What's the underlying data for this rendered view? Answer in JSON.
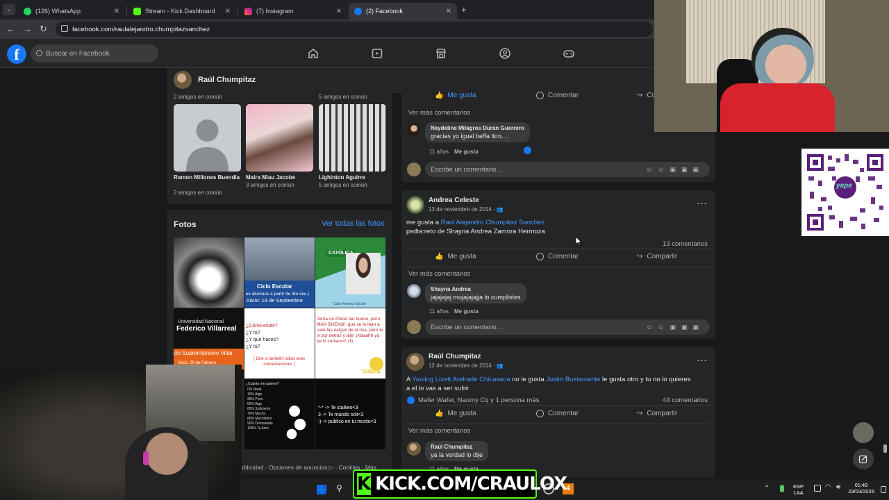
{
  "browser": {
    "tabs": [
      {
        "label": "(126) WhatsApp",
        "color": "#25d366",
        "icon": "whatsapp-icon"
      },
      {
        "label": "Stream - Kick Dashboard",
        "color": "#53fc18",
        "icon": "kick-icon"
      },
      {
        "label": "(7) Instagram",
        "color": "#e1306c",
        "icon": "instagram-icon"
      },
      {
        "label": "(2) Facebook",
        "color": "#1877f2",
        "icon": "facebook-icon"
      }
    ],
    "new_tab": "+",
    "url": "facebook.com/raulalejandro.chumpitazsanchez"
  },
  "header": {
    "logo": "f",
    "search_placeholder": "Buscar en Facebook",
    "nav_icons": [
      "home-icon",
      "video-icon",
      "marketplace-icon",
      "groups-icon",
      "gaming-icon"
    ]
  },
  "profile": {
    "name": "Raúl Chumpitaz"
  },
  "friends": {
    "top_subs": [
      "2 amigos en común",
      "5 amigos en común"
    ],
    "items": [
      {
        "name": "Ramon Millones Buendia",
        "mutual": "2 amigos en común"
      },
      {
        "name": "Maira Miau Jacobe",
        "mutual": "3 amigos en común"
      },
      {
        "name": "Lighinton Aguirre",
        "mutual": "5 amigos en común"
      }
    ]
  },
  "photos": {
    "title": "Fotos",
    "see_all": "Ver todas las fotos",
    "captions": {
      "p2a": "Ciclo Escolar",
      "p2b": "ex alumnos a partir de 4to sec.)",
      "p2c": "Inicio: 19 de Septiembre",
      "p3a": "CATÓLICA",
      "p3b": "Ciclo Primera Opción",
      "p4a": "Universidad Nacional",
      "p4b": "Federico Villarreal",
      "p4c": "clo Superintensivo Villar",
      "p4d": "Inicio: 29 de Febrero",
      "p5a": "¿Cómo estás?",
      "p5b": "¿Y tú?",
      "p5c": "¿Y qué haces?",
      "p5d": "¿Y tú?",
      "p5e": "( Like si también odias esas conversaciones )",
      "p6a": "Tenía un chiste tan bueno, pero MAN BUENO!, que se le iban a caer las nalgas de la risa, pero te vi por detrás y dije: ¡Naaahh ya se lo contaron! xD",
      "p6b": "CHISTE",
      "p7a": "¿Cuánto me quieres?",
      "p7b": "0% Nada",
      "p7c": "10% Algo",
      "p7d": "25% Poco",
      "p7e": "50% Algo",
      "p7f": "60% Suficiente",
      "p7g": "70% Mucho",
      "p7h": "80% Muchísimo",
      "p7i": "90% Demasiado",
      "p7j": "100% Te Amo",
      "p8a": "*-* -> Te stalkeo<3",
      "p8b": "3 -> Te mando soli<3",
      "p8c": ":) -> publico en tu murito<3"
    }
  },
  "footer": "ublicidad · Opciones de anuncios ▷ · Cookies · Más",
  "posts": [
    {
      "actions": [
        "Me gusta",
        "Comentar",
        "Compartir"
      ],
      "see_more": "Ver más comentarios",
      "comment": {
        "name": "Naydeline Milagros Duran Guerrero",
        "text": "gracias yo igual beffa tkm....",
        "age": "11 años",
        "like": "Me gusta"
      },
      "write": "Escribe un comentario..."
    },
    {
      "author": "Andrea Celeste",
      "date": "13 de noviembre de 2014 · ",
      "text_prefix": "me gusta a ",
      "text_link": "Raul Alejandro Chumpitaz Sanchez",
      "text_line2": "psdta:reto de Shayna Andrea Zamora Hermoza",
      "comments_count": "13 comentarios",
      "actions": [
        "Me gusta",
        "Comentar",
        "Compartir"
      ],
      "see_more": "Ver más comentarios",
      "comment": {
        "name": "Shayna Andrea",
        "text": "jajajajaj mujajajajja lo cumplistes",
        "age": "11 años",
        "like": "Me gusta"
      },
      "write": "Escribe un comentario..."
    },
    {
      "author": "Raúl Chumpitaz",
      "date": "12 de noviembre de 2014 · ",
      "t1": "A ",
      "link1": "Youling Lizett Andrade Chicasaca",
      "t2": " no le gusta  ",
      "link2": "Jostin Bustamante",
      "t3": " le gusta otro y tu no lo quieres",
      "line2": "a el lo vas a ser sufrir",
      "reactions": "Mafer Wafer, Naomy Cq y 1 persona más",
      "comments_count": "44 comentarios",
      "actions": [
        "Me gusta",
        "Comentar",
        "Compartir"
      ],
      "see_more": "Ver más comentarios",
      "comment": {
        "name": "Raúl Chumpitaz",
        "text": "ya la verdad lo dije",
        "age": "11 años",
        "like": "Me gusta"
      }
    }
  ],
  "stream": {
    "banner_letter": "K",
    "banner_text": "KICK.COM/CRAULOX",
    "qr_label": "yape"
  },
  "taskbar": {
    "lang": "ESP",
    "region": "LAA",
    "time": "01:49",
    "date": "23/03/2026",
    "badge": "4"
  },
  "colors": {
    "accent": "#1877f2",
    "kick": "#53fc18",
    "bg": "#18191a",
    "card": "#242526"
  }
}
